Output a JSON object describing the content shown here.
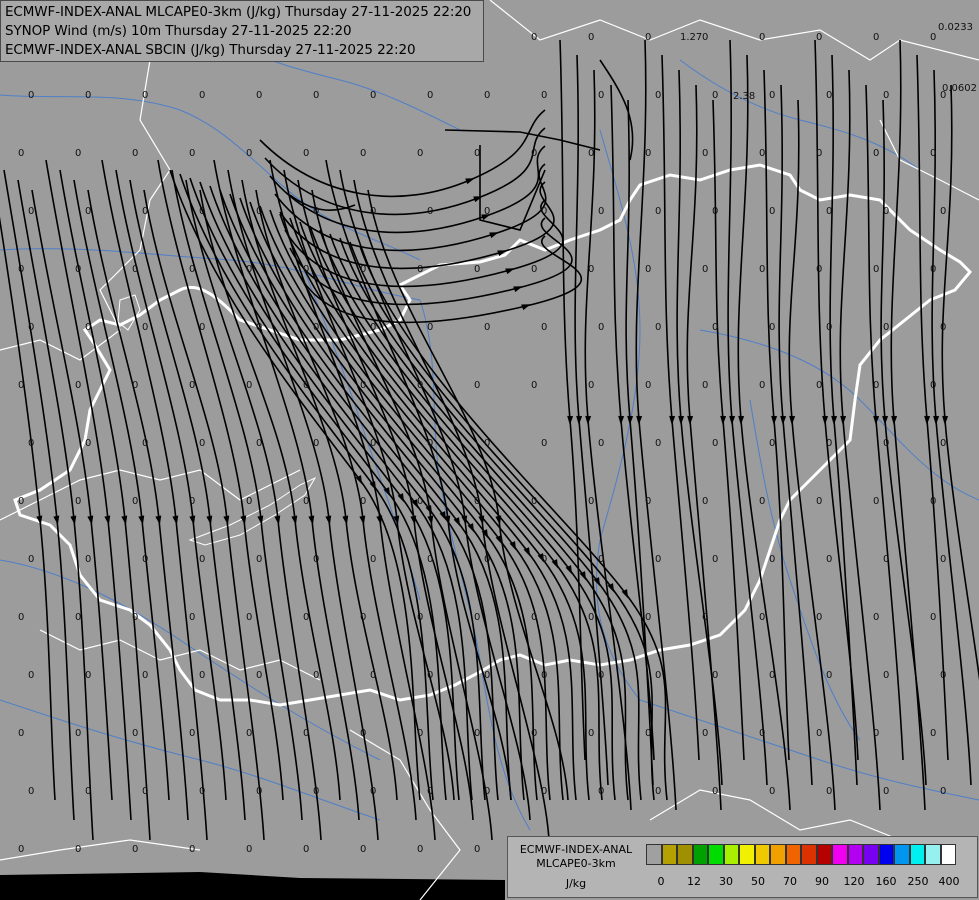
{
  "header": {
    "line1": "ECMWF-INDEX-ANAL MLCAPE0-3km (J/kg) Thursday 27-11-2025 22:20",
    "line2": "SYNOP Wind (m/s) 10m Thursday 27-11-2025 22:20",
    "line3": "ECMWF-INDEX-ANAL SBCIN (J/kg) Thursday 27-11-2025 22:20"
  },
  "point_labels": {
    "zero": "0",
    "v1": "1.27",
    "v2": "2.38",
    "v3": "0.0233",
    "v4": "0.0602"
  },
  "legend": {
    "title": "ECMWF-INDEX-ANAL MLCAPE0-3km",
    "unit": "J/kg",
    "colors": [
      "#a0a0a0",
      "#b4a000",
      "#a09000",
      "#00a000",
      "#00dc00",
      "#a8f000",
      "#f0f000",
      "#f0c800",
      "#f0a000",
      "#f06400",
      "#dc3200",
      "#b40000",
      "#f000f0",
      "#b400f0",
      "#7800f0",
      "#0000f0",
      "#0096f0",
      "#00f0f0",
      "#96f0f0",
      "#ffffff"
    ],
    "tick_labels": [
      "0",
      "12",
      "30",
      "50",
      "70",
      "90",
      "120",
      "160",
      "250",
      "400"
    ]
  }
}
